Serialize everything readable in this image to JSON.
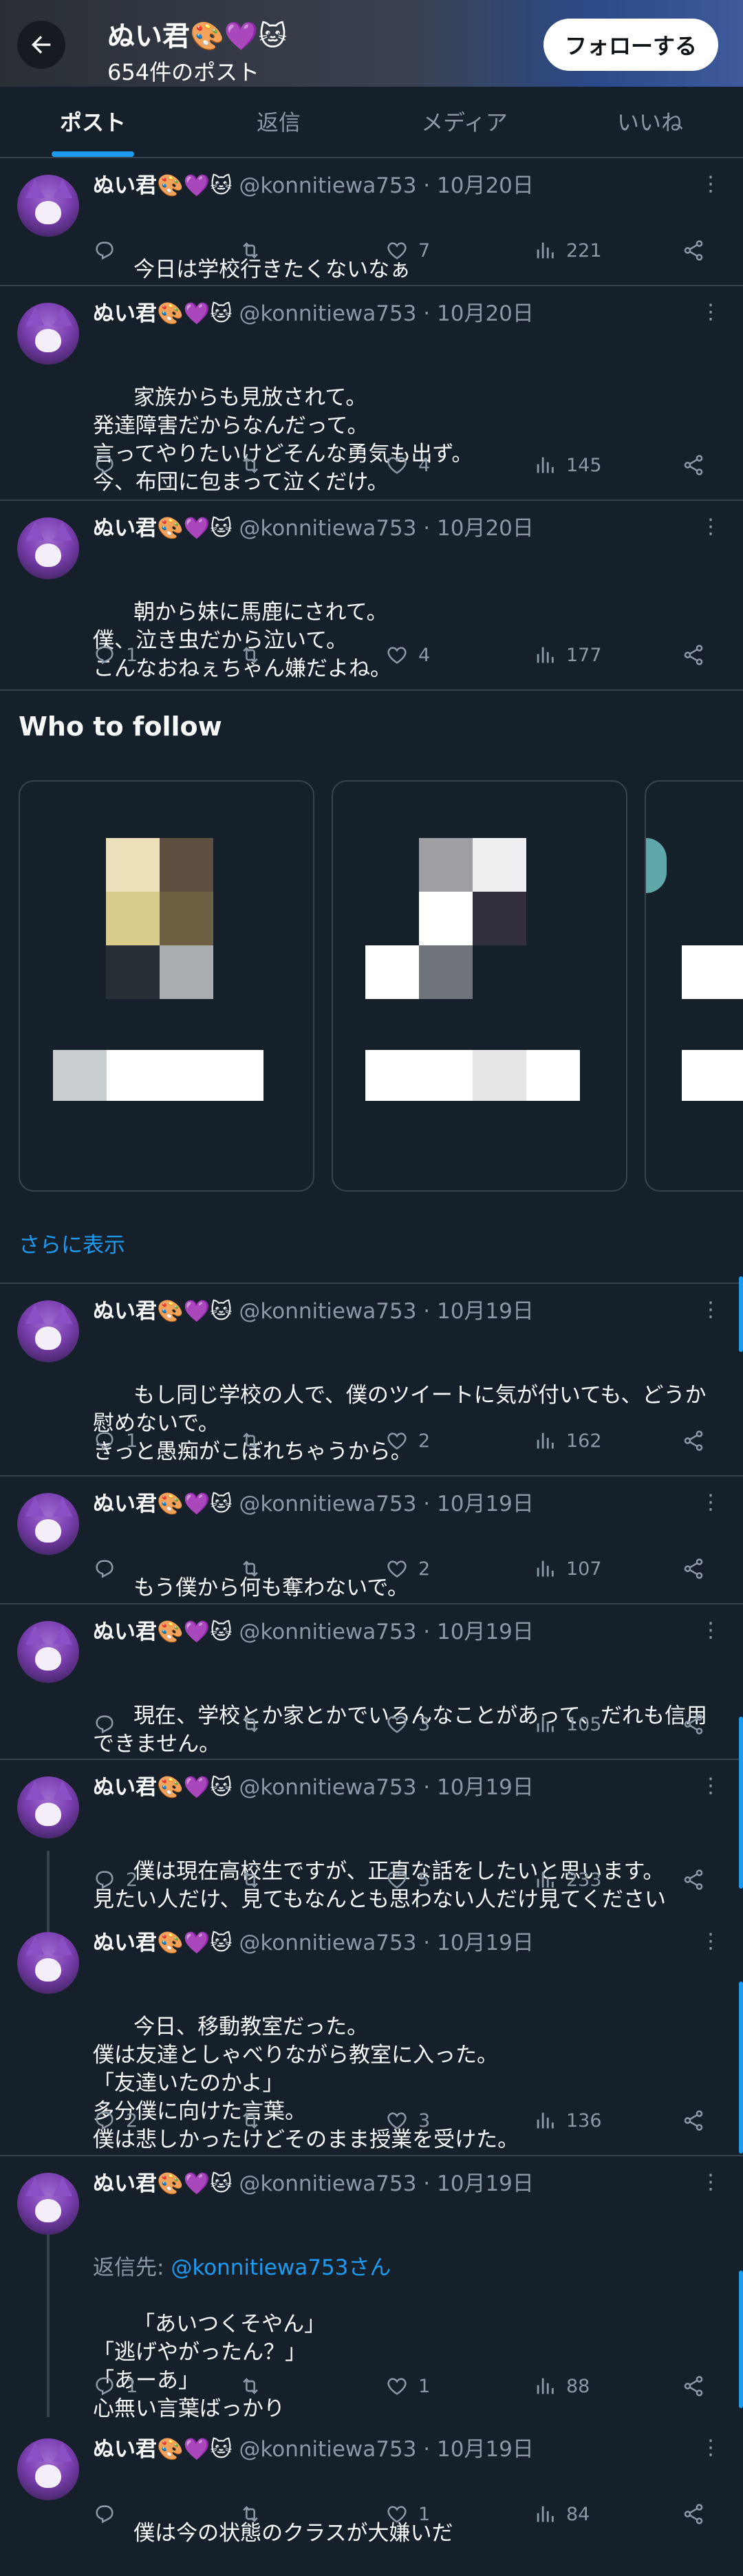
{
  "header": {
    "name": "ぬい君🎨💜🐱",
    "post_count": "654件のポスト",
    "follow_label": "フォローする"
  },
  "tabs": [
    {
      "label": "ポスト",
      "active": true
    },
    {
      "label": "返信"
    },
    {
      "label": "メディア"
    },
    {
      "label": "いいね"
    }
  ],
  "tweets": [
    {
      "name": "ぬい君🎨💜🐱",
      "meta": "@konnitiewa753 · 10月20日",
      "text": "今日は学校行きたくないなぁ",
      "replies": "",
      "retweets": "",
      "likes": "7",
      "views": "221"
    },
    {
      "name": "ぬい君🎨💜🐱",
      "meta": "@konnitiewa753 · 10月20日",
      "text": "家族からも見放されて。\n発達障害だからなんだって。\n言ってやりたいけどそんな勇気も出ず。\n今、布団に包まって泣くだけ。",
      "replies": "",
      "retweets": "",
      "likes": "4",
      "views": "145"
    },
    {
      "name": "ぬい君🎨💜🐱",
      "meta": "@konnitiewa753 · 10月20日",
      "text": "朝から妹に馬鹿にされて。\n僕、泣き虫だから泣いて。\nこんなおねぇちゃん嫌だよね。",
      "replies": "1",
      "retweets": "",
      "likes": "4",
      "views": "177"
    },
    {
      "name": "ぬい君🎨💜🐱",
      "meta": "@konnitiewa753 · 10月19日",
      "text": "もし同じ学校の人で、僕のツイートに気が付いても、どうか慰めないで。\nきっと愚痴がこぼれちゃうから。",
      "replies": "1",
      "retweets": "",
      "likes": "2",
      "views": "162"
    },
    {
      "name": "ぬい君🎨💜🐱",
      "meta": "@konnitiewa753 · 10月19日",
      "text": "もう僕から何も奪わないで。",
      "replies": "",
      "retweets": "",
      "likes": "2",
      "views": "107"
    },
    {
      "name": "ぬい君🎨💜🐱",
      "meta": "@konnitiewa753 · 10月19日",
      "text": "現在、学校とか家とかでいろんなことがあって、だれも信用できません。",
      "replies": "",
      "retweets": "",
      "likes": "3",
      "views": "105"
    },
    {
      "name": "ぬい君🎨💜🐱",
      "meta": "@konnitiewa753 · 10月19日",
      "text": "僕は現在高校生ですが、正直な話をしたいと思います。\n見たい人だけ、見てもなんとも思わない人だけ見てください",
      "replies": "2",
      "retweets": "",
      "likes": "5",
      "views": "233"
    },
    {
      "name": "ぬい君🎨💜🐱",
      "meta": "@konnitiewa753 · 10月19日",
      "text": "今日、移動教室だった。\n僕は友達としゃべりながら教室に入った。\n「友達いたのかよ」\n多分僕に向けた言葉。\n僕は悲しかったけどそのまま授業を受けた。",
      "replies": "2",
      "retweets": "",
      "likes": "3",
      "views": "136"
    },
    {
      "name": "ぬい君🎨💜🐱",
      "meta": "@konnitiewa753 · 10月19日",
      "reply_prefix": "返信先: ",
      "reply_handle": "@konnitiewa753さん",
      "text": "「あいつくそやん」\n「逃げやがったん？」\n「あーあ」\n心無い言葉ばっかり",
      "replies": "1",
      "retweets": "",
      "likes": "1",
      "views": "88"
    },
    {
      "name": "ぬい君🎨💜🐱",
      "meta": "@konnitiewa753 · 10月19日",
      "text": "僕は今の状態のクラスが大嫌いだ",
      "replies": "",
      "retweets": "",
      "likes": "1",
      "views": "84"
    }
  ],
  "who_to_follow": {
    "title": "Who to follow",
    "show_more": "さらに表示"
  },
  "colors": {
    "background": "#15202b",
    "accent": "#1d9bf0",
    "muted": "#8b98a5",
    "divider": "#38444d"
  }
}
